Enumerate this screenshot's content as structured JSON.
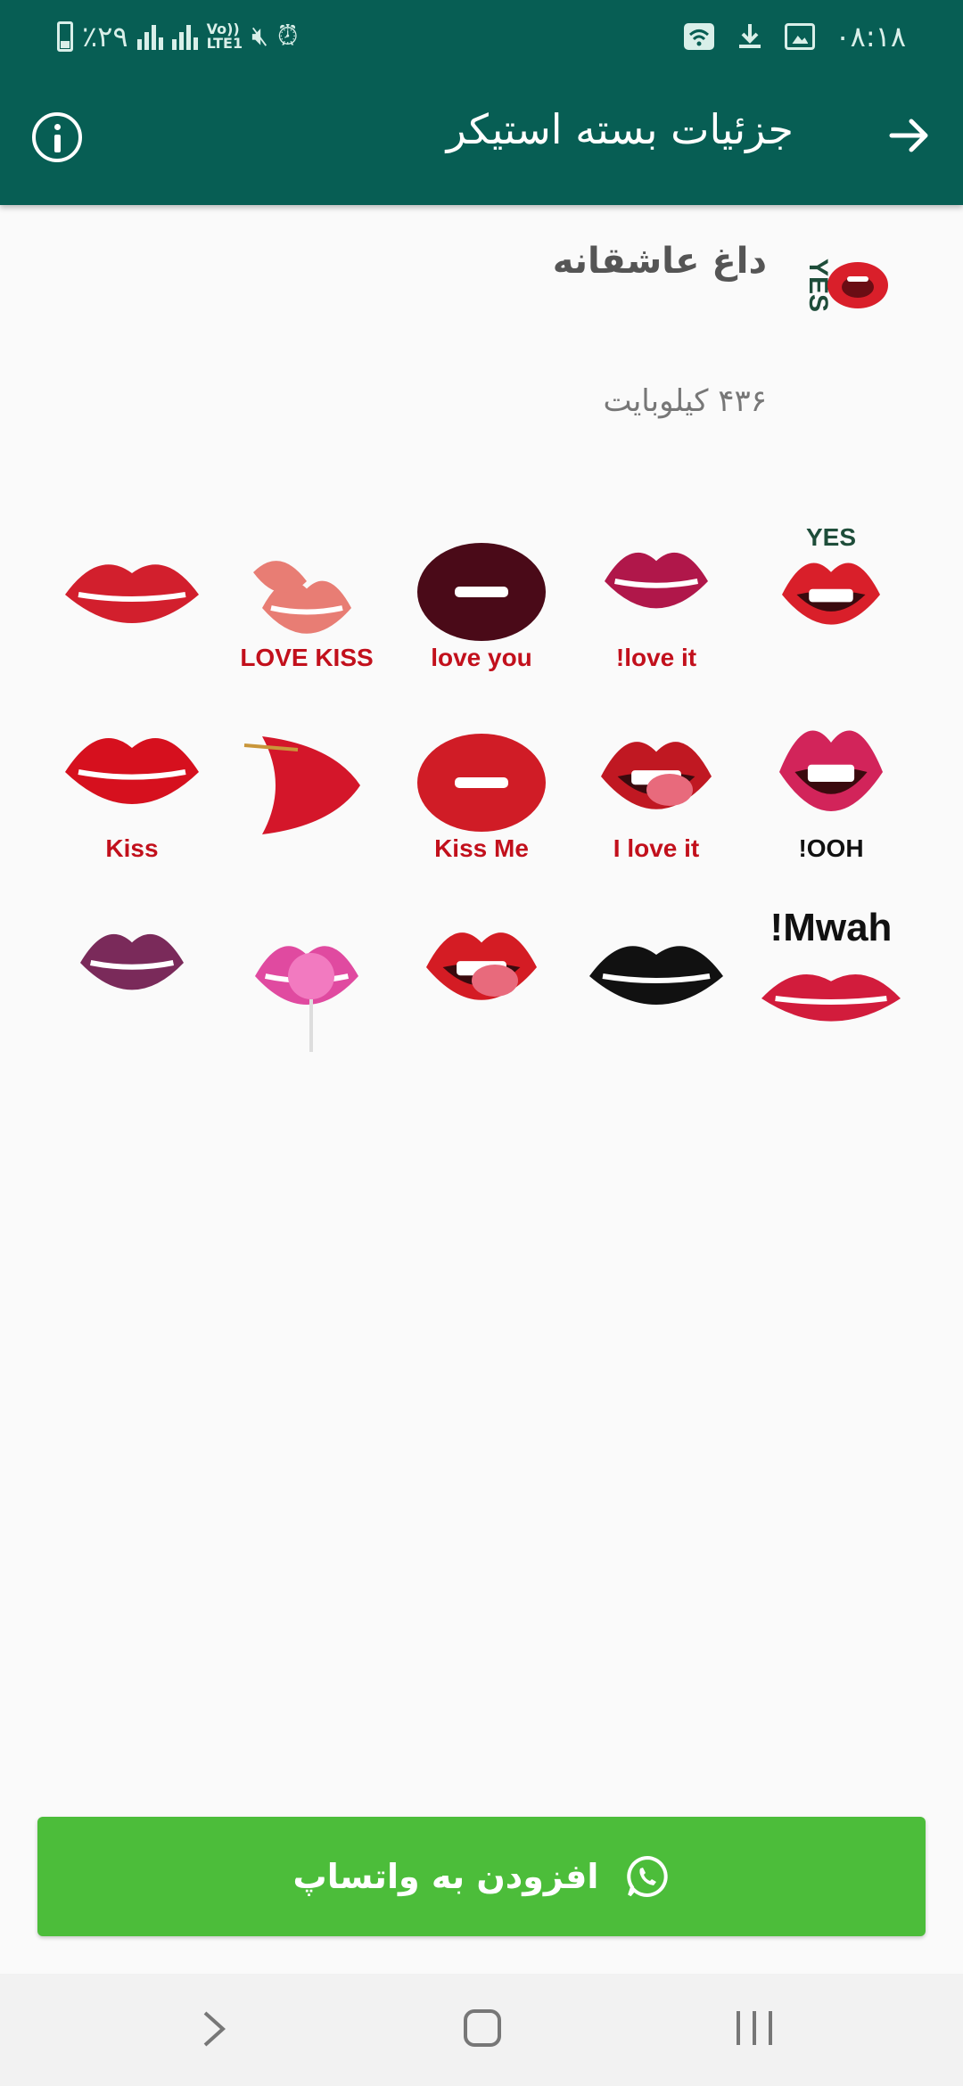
{
  "status_bar": {
    "time": "۰۸:۱۸",
    "battery_text": "٪۲۹",
    "network_label_top": "Vo))",
    "network_label_bottom": "LTE1"
  },
  "app_bar": {
    "title": "جزئیات بسته استیکر",
    "back_icon": "arrow-right-icon",
    "info_icon": "info-icon"
  },
  "pack": {
    "name": "داغ عاشقانه",
    "size": "۴۳۶ کیلوبایت",
    "tray_text": "YES"
  },
  "stickers": [
    {
      "label": "YES",
      "kind": "yes",
      "color": "#d91f2a"
    },
    {
      "label": "love it!",
      "kind": "bite",
      "color": "#b0174a"
    },
    {
      "label": "love you",
      "kind": "words",
      "color": "#4a0a18"
    },
    {
      "label": "LOVE KISS",
      "kind": "kiss2",
      "color": "#e87d74"
    },
    {
      "label": "",
      "kind": "smile",
      "color": "#d21f2d"
    },
    {
      "label": "OOH!",
      "kind": "ooh",
      "color": "#d2245a"
    },
    {
      "label": "I love it",
      "kind": "tongue",
      "color": "#c01822"
    },
    {
      "label": "Kiss Me",
      "kind": "words",
      "color": "#d01c26"
    },
    {
      "label": "",
      "kind": "side",
      "color": "#d4162a"
    },
    {
      "label": "Kiss",
      "kind": "print",
      "color": "#d6101e"
    },
    {
      "label": "Mwah!",
      "kind": "mwah",
      "color": "#d21c3c"
    },
    {
      "label": "",
      "kind": "smile",
      "color": "#111111"
    },
    {
      "label": "",
      "kind": "tongue2",
      "color": "#d41c24"
    },
    {
      "label": "",
      "kind": "lolly",
      "color": "#e04aa0"
    },
    {
      "label": "",
      "kind": "bite2",
      "color": "#7a2a5a"
    }
  ],
  "add_button": {
    "label": "افزودن به واتساپ",
    "icon": "whatsapp-icon",
    "color": "#4cbd3a"
  },
  "nav_bar": {
    "back_icon": "chevron-icon",
    "home_icon": "home-icon",
    "recents_icon": "recents-icon"
  },
  "colors": {
    "app_bar": "#075e54",
    "background": "#fafafa"
  }
}
